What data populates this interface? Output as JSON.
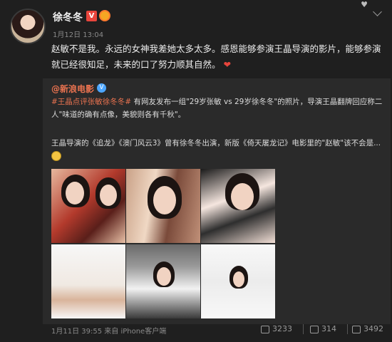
{
  "header": {
    "username": "徐冬冬",
    "verified_badge": "V",
    "timestamp": "1月12日 13:04",
    "menu_icon": "chevron-down-icon"
  },
  "post": {
    "text": "赵敏不是我。永远的女神我差她太多太多。感恩能够参演王晶导演的影片，能够参演就已经很知足，未来的口了努力顺其自然。",
    "heart": "❤"
  },
  "repost": {
    "source_name": "@新浪电影",
    "source_verified": "V",
    "hashtag": "#王晶点评张敏徐冬冬#",
    "text1": "有网友发布一组\"29岁张敏 vs 29岁徐冬冬\"的照片，导演王晶翻牌回应称二人\"味道的确有点像，美貌则各有千秋\"。",
    "text2": "王晶导演的《追龙》《澳门风云3》曾有徐冬冬出演，新版《倚天屠龙记》电影里的\"赵敏\"该不会是..."
  },
  "footer": {
    "meta": "1月11日 39:55 来自 iPhone客户端",
    "shares": "3233",
    "comments": "314",
    "likes": "3492"
  }
}
